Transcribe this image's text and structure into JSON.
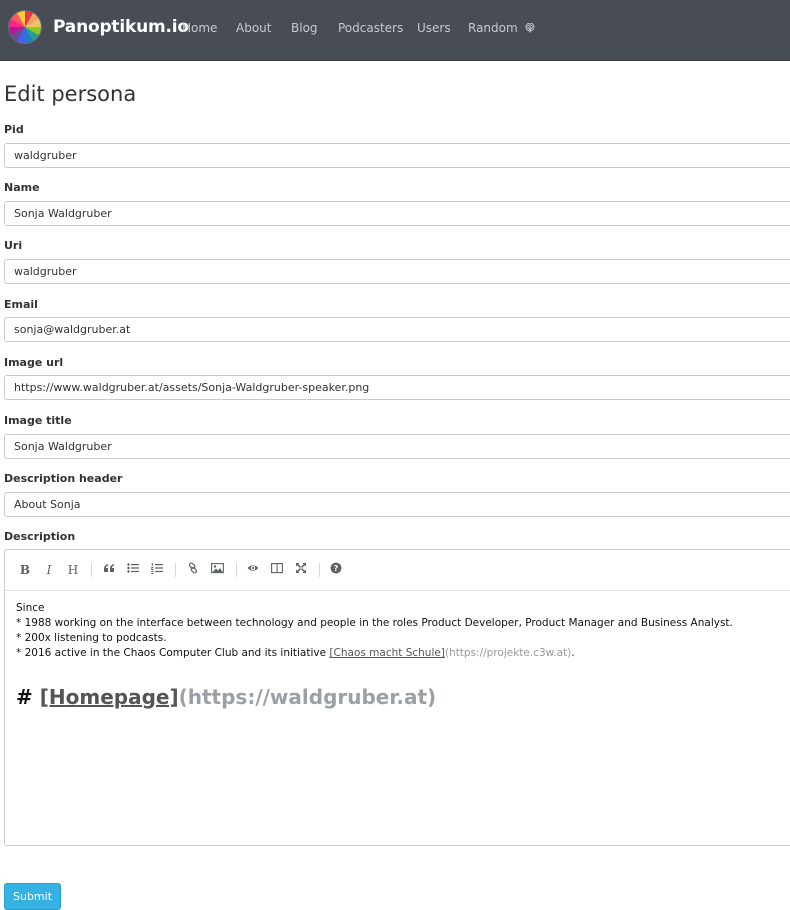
{
  "navbar": {
    "brand": "Panoptikum.io",
    "items": [
      {
        "label": "Home"
      },
      {
        "label": "About"
      },
      {
        "label": "Blog"
      },
      {
        "label": "Podcasters"
      },
      {
        "label": "Users"
      },
      {
        "label": "Random",
        "icon": "podcast-icon"
      }
    ]
  },
  "page": {
    "title": "Edit persona"
  },
  "form": {
    "fields": [
      {
        "label": "Pid",
        "value": "waldgruber"
      },
      {
        "label": "Name",
        "value": "Sonja Waldgruber"
      },
      {
        "label": "Uri",
        "value": "waldgruber"
      },
      {
        "label": "Email",
        "value": "sonja@waldgruber.at"
      },
      {
        "label": "Image url",
        "value": "https://www.waldgruber.at/assets/Sonja-Waldgruber-speaker.png"
      },
      {
        "label": "Image title",
        "value": "Sonja Waldgruber"
      },
      {
        "label": "Description header",
        "value": "About Sonja"
      }
    ],
    "description_label": "Description",
    "toolbar": {
      "bold": "B",
      "italic": "I",
      "heading": "H",
      "icons": [
        "bold-icon",
        "italic-icon",
        "heading-icon",
        "quote-icon",
        "unordered-list-icon",
        "ordered-list-icon",
        "link-icon",
        "image-icon",
        "preview-icon",
        "side-by-side-icon",
        "fullscreen-icon",
        "guide-icon"
      ]
    },
    "description": {
      "line1": "Since",
      "line2": "* 1988 working on the interface between technology and people in the roles Product Developer, Product Manager and Business Analyst.",
      "line3": "* 200x listening to podcasts.",
      "line4_prefix": "* 2016 active in the Chaos Computer Club and its initiative ",
      "line4_link": "[Chaos macht Schule]",
      "line4_url": "(https://projekte.c3w.at)",
      "line4_suffix": ".",
      "heading_hash": "# ",
      "heading_link": "[Homepage]",
      "heading_url": "(https://waldgruber.at)"
    },
    "submit_label": "Submit"
  }
}
